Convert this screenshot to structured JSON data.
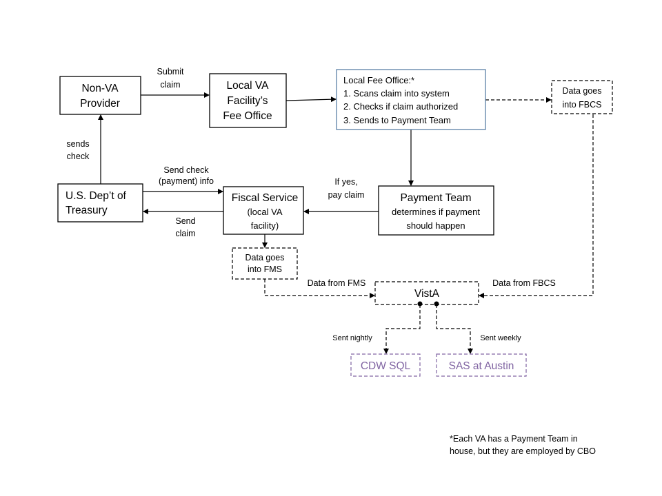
{
  "nodes": {
    "provider": [
      "Non-VA",
      "Provider"
    ],
    "facility_fee_office": [
      "Local VA",
      "Facility’s",
      "Fee Office"
    ],
    "local_fee_office": [
      "Local Fee Office:*",
      "1. Scans claim into system",
      "2. Checks if claim authorized",
      "3. Sends to Payment Team"
    ],
    "fbcs": [
      "Data goes",
      "into FBCS"
    ],
    "treasury": [
      "U.S. Dep’t of",
      "Treasury"
    ],
    "fiscal": [
      "Fiscal Service",
      "(local VA",
      "facility)"
    ],
    "payment_team": [
      "Payment Team",
      "determines if payment",
      "should happen"
    ],
    "fms": [
      "Data goes",
      "into FMS"
    ],
    "vista": "VistA",
    "cdw": "CDW SQL",
    "sas": "SAS at Austin"
  },
  "edges": {
    "submit_claim": [
      "Submit",
      "claim"
    ],
    "sends_check": [
      "sends",
      "check"
    ],
    "send_check_info": [
      "Send check",
      "(payment) info"
    ],
    "send_claim": [
      "Send",
      "claim"
    ],
    "if_yes": [
      "If yes,",
      "pay claim"
    ],
    "data_from_fms": "Data from FMS",
    "data_from_fbcs": "Data from FBCS",
    "sent_nightly": "Sent nightly",
    "sent_weekly": "Sent weekly"
  },
  "footnote": [
    "*Each VA has a Payment Team in",
    "house, but they are employed by CBO"
  ],
  "colors": {
    "local_fee_office_border": "#5b7fa6",
    "output_boxes": "#8064a2"
  }
}
